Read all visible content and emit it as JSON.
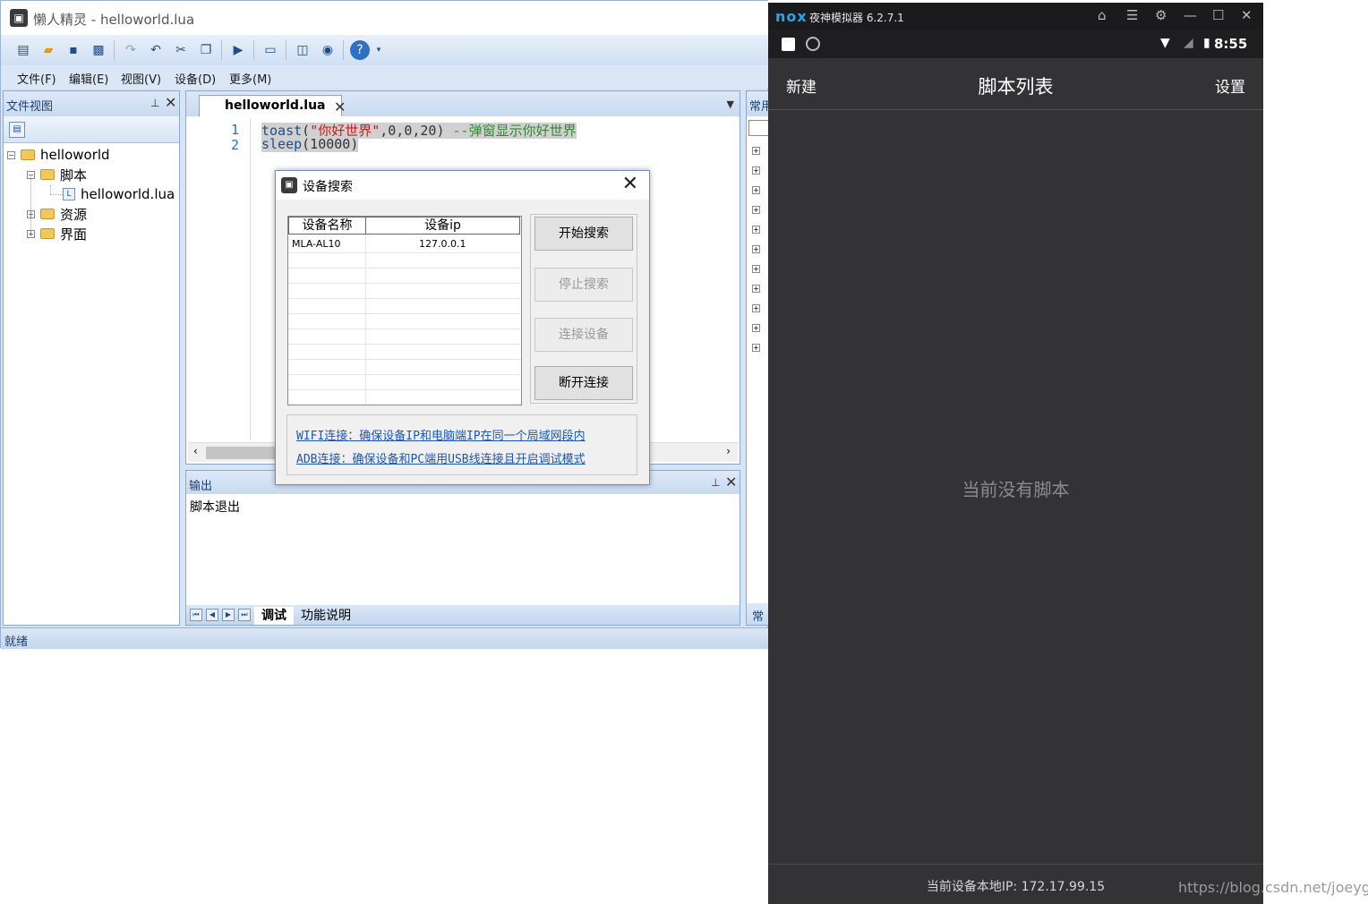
{
  "ide": {
    "title": "懒人精灵 - helloworld.lua",
    "menu": [
      "文件(F)",
      "编辑(E)",
      "视图(V)",
      "设备(D)",
      "更多(M)"
    ],
    "file_panel": {
      "title": "文件视图",
      "tree": [
        {
          "label": "helloworld",
          "level": 0,
          "toggle": "−",
          "kind": "folder"
        },
        {
          "label": "脚本",
          "level": 1,
          "toggle": "−",
          "kind": "folder"
        },
        {
          "label": "helloworld.lua",
          "level": 2,
          "toggle": "",
          "kind": "file"
        },
        {
          "label": "资源",
          "level": 1,
          "toggle": "+",
          "kind": "folder"
        },
        {
          "label": "界面",
          "level": 1,
          "toggle": "+",
          "kind": "folder"
        }
      ]
    },
    "editor": {
      "tab_label": "helloworld.lua",
      "lines": [
        {
          "number": "1",
          "fn": "toast",
          "open": "(",
          "str": "\"你好世界\"",
          "args": ",0,0,20)",
          "comment": " --弹窗显示你好世界"
        },
        {
          "number": "2",
          "fn": "sleep",
          "open": "",
          "str": "",
          "args": "(10000)",
          "comment": ""
        }
      ]
    },
    "output": {
      "title": "输出",
      "text": "脚本退出",
      "tabs": [
        "调试",
        "功能说明"
      ]
    },
    "right_panel": {
      "title": "常用",
      "footer": "常用"
    },
    "status": "就绪"
  },
  "dialog": {
    "title": "设备搜索",
    "columns": [
      "设备名称",
      "设备ip"
    ],
    "rows": [
      {
        "name": "MLA-AL10",
        "ip": "127.0.0.1"
      }
    ],
    "buttons": {
      "start": "开始搜索",
      "stop": "停止搜索",
      "connect": "连接设备",
      "disconnect": "断开连接"
    },
    "hints": {
      "wifi": "WIFI连接：确保设备IP和电脑端IP在同一个局域网段内",
      "adb": "ADB连接：确保设备和PC端用USB线连接且开启调试模式"
    }
  },
  "emulator": {
    "logo": "nox",
    "name": "夜神模拟器 6.2.7.1",
    "time": "8:55",
    "app_bar": {
      "left": "新建",
      "title": "脚本列表",
      "right": "设置"
    },
    "empty_text": "当前没有脚本",
    "footer_ip": "当前设备本地IP: 172.17.99.15"
  },
  "watermark": "https://blog.csdn.net/joeygoo"
}
